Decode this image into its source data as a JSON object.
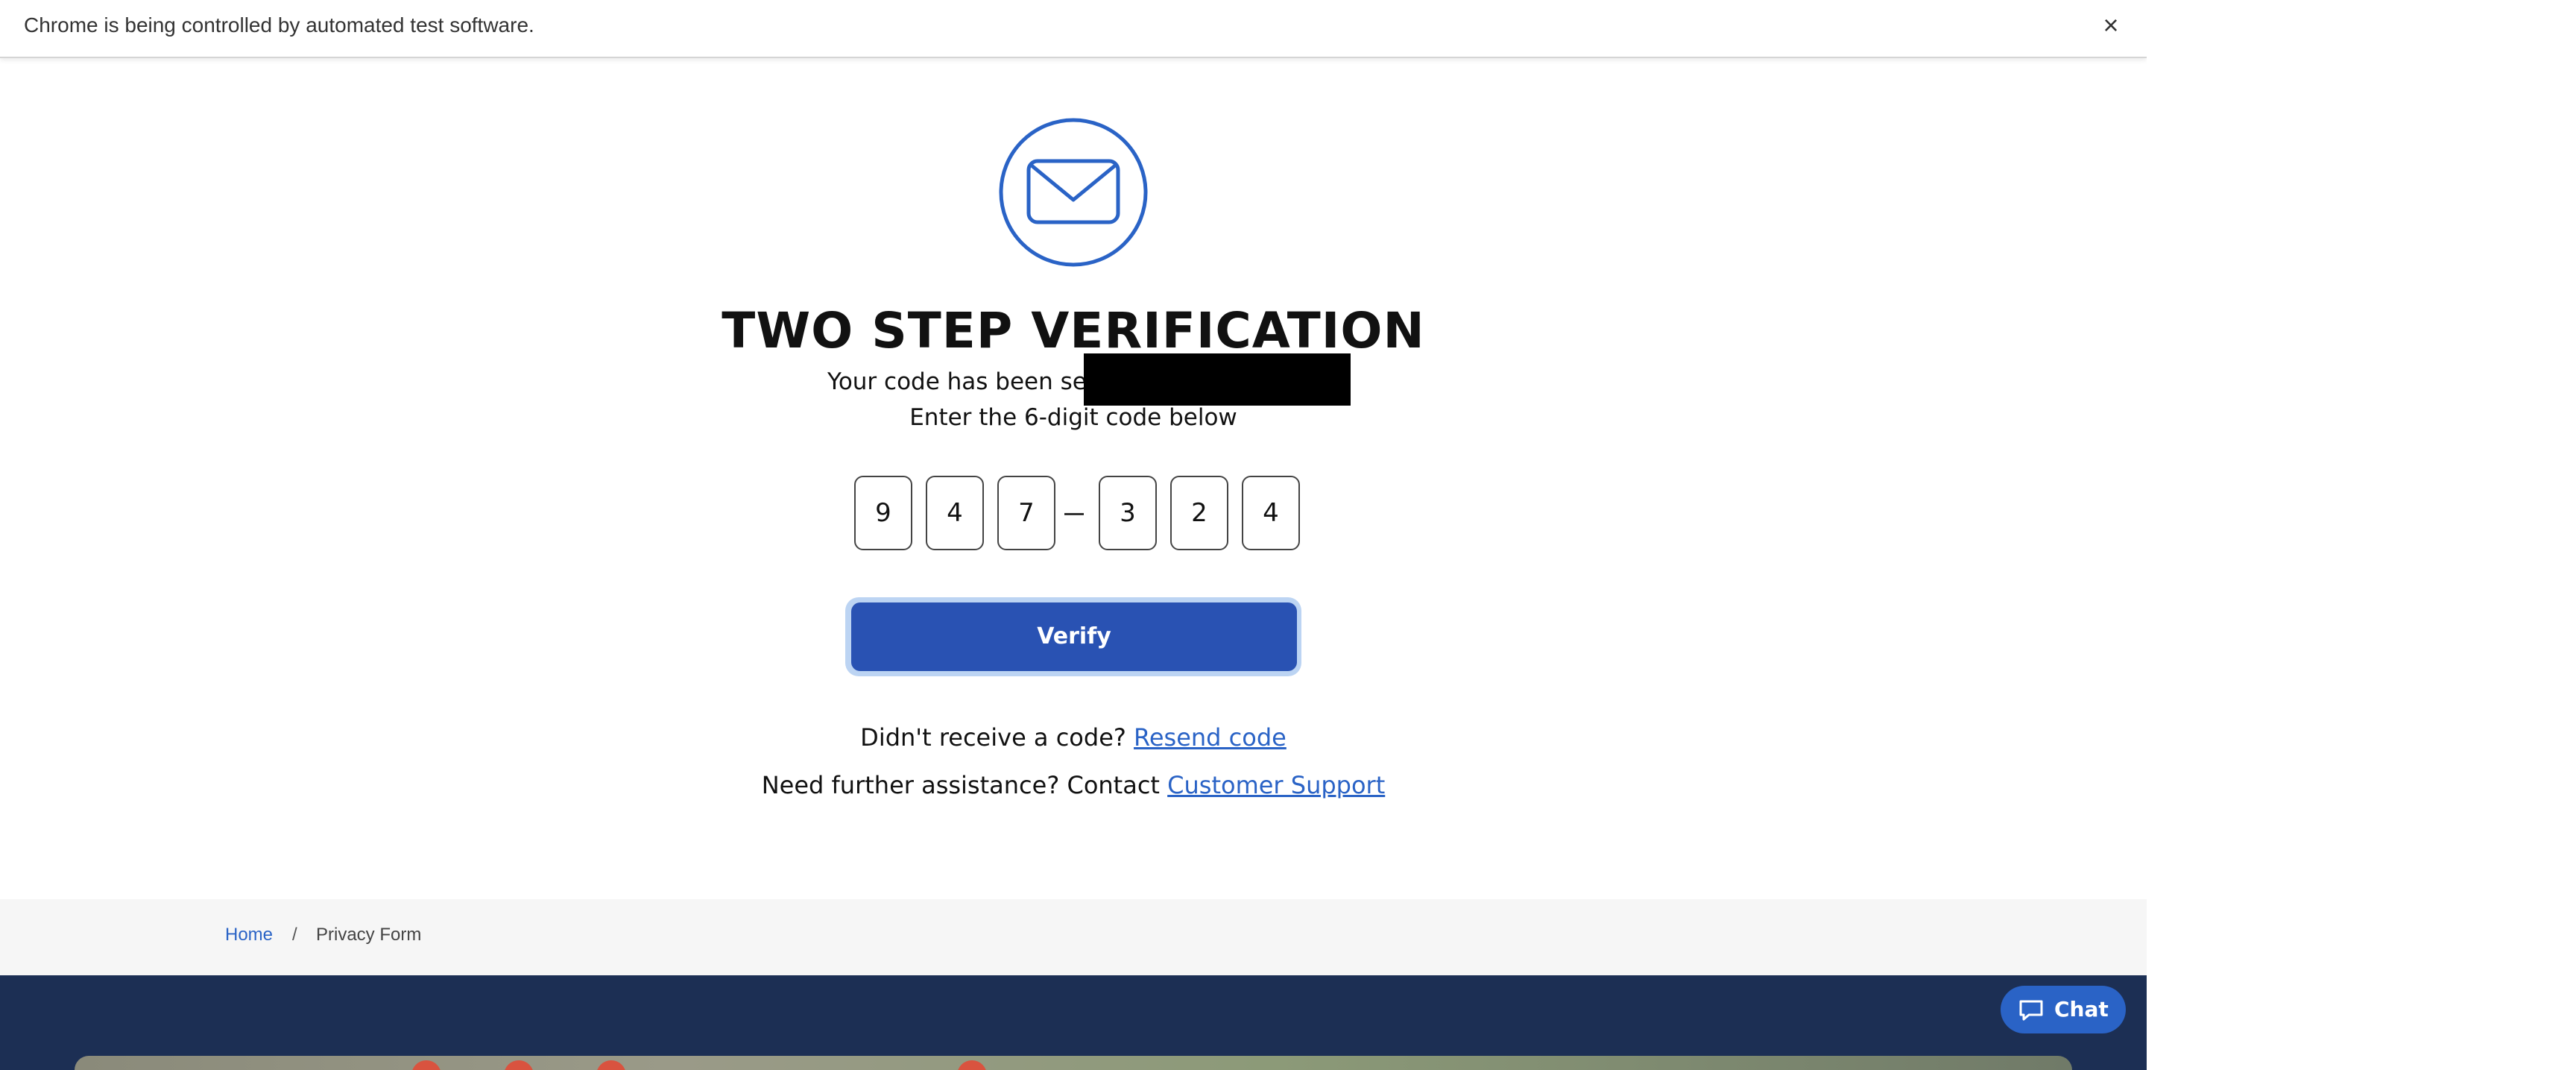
{
  "infobar": {
    "message": "Chrome is being controlled by automated test software.",
    "close_glyph": "×"
  },
  "verification": {
    "icon": "envelope-icon",
    "title": "TWO STEP VERIFICATION",
    "sent_text": "Your code has been sent to",
    "instructions": "Enter the 6-digit code below",
    "digits": [
      "9",
      "4",
      "7",
      "3",
      "2",
      "4"
    ],
    "verify_label": "Verify",
    "resend_prompt": "Didn't receive a code?",
    "resend_link": "Resend code",
    "support_prompt": "Need further assistance? Contact",
    "support_link": "Customer Support"
  },
  "breadcrumb": {
    "home": "Home",
    "separator": "/",
    "current": "Privacy Form"
  },
  "chat": {
    "label": "Chat",
    "icon": "chat-bubble-icon"
  },
  "colors": {
    "accent": "#2952b3",
    "link": "#2a63c6",
    "footer": "#1c2f54"
  }
}
